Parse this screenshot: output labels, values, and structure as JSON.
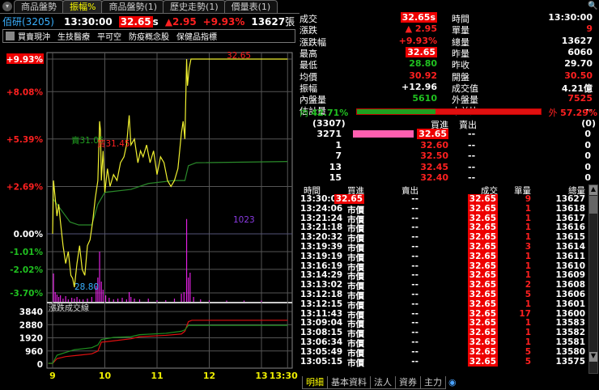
{
  "tabs": [
    "商品盤勢",
    "振幅%",
    "商品盤勢(1)",
    "歷史走勢(1)",
    "價量表(1)"
  ],
  "active_tab": 1,
  "header": {
    "stock": "佰研(3205)",
    "time": "13:30:00",
    "price": "32.65",
    "price_flag": "s",
    "change": "▲2.95",
    "pct": "+9.93%",
    "volume": "13627",
    "volume_unit": "張"
  },
  "toolbar": [
    "買賣現沖",
    "生技醫療",
    "平可空",
    "防疫概念股",
    "保健品指標"
  ],
  "quote_left": [
    {
      "label": "成交",
      "value": "32.65s",
      "color": "box"
    },
    {
      "label": "漲跌",
      "value": "▲ 2.95",
      "color": "red"
    },
    {
      "label": "漲跌幅",
      "value": "+9.93%",
      "color": "red"
    },
    {
      "label": "最高",
      "value": "32.65",
      "color": "box"
    },
    {
      "label": "最低",
      "value": "28.80",
      "color": "green"
    },
    {
      "label": "均價",
      "value": "30.92",
      "color": "red"
    },
    {
      "label": "振幅",
      "value": "+12.96",
      "color": "white"
    },
    {
      "label": "內盤量",
      "value": "5610",
      "color": "green"
    },
    {
      "label": "估計量",
      "value": "--",
      "color": "white"
    }
  ],
  "quote_right": [
    {
      "label": "時間",
      "value": "13:30:00",
      "color": "white"
    },
    {
      "label": "單量",
      "value": "9",
      "color": "red"
    },
    {
      "label": "總量",
      "value": "13627",
      "color": "white"
    },
    {
      "label": "昨量",
      "value": "6060",
      "color": "white"
    },
    {
      "label": "昨收",
      "value": "29.70",
      "color": "white"
    },
    {
      "label": "開盤",
      "value": "30.50",
      "color": "red"
    },
    {
      "label": "成交值",
      "value": "4.21億",
      "color": "white"
    },
    {
      "label": "外盤量",
      "value": "7525",
      "color": "red"
    },
    {
      "label": "本益比",
      "value": "--",
      "color": "white"
    }
  ],
  "inout": {
    "in_label": "內",
    "in_pct": "42.71%",
    "out_label": "外",
    "out_pct": "57.29%",
    "in_fraction": 0.4271
  },
  "orderbook": {
    "bid_total": "(3307)",
    "bid_header": "買進",
    "ask_header": "賣出",
    "ask_total": "(0)",
    "rows": [
      {
        "bid_vol": "3271",
        "bid": "32.65",
        "ask": "--",
        "ask_vol": "0",
        "bar": 1
      },
      {
        "bid_vol": "1",
        "bid": "32.60",
        "ask": "--",
        "ask_vol": "0",
        "bar": 0
      },
      {
        "bid_vol": "7",
        "bid": "32.50",
        "ask": "--",
        "ask_vol": "0",
        "bar": 0
      },
      {
        "bid_vol": "13",
        "bid": "32.45",
        "ask": "--",
        "ask_vol": "0",
        "bar": 0
      },
      {
        "bid_vol": "15",
        "bid": "32.40",
        "ask": "--",
        "ask_vol": "0",
        "bar": 0
      }
    ]
  },
  "ticks": {
    "headers": [
      "時間",
      "買進",
      "賣出",
      "成交",
      "單量",
      "總量"
    ],
    "rows": [
      [
        "13:30:00",
        "32.65",
        "--",
        "32.65",
        "9",
        "13627"
      ],
      [
        "13:24:06",
        "市價",
        "--",
        "32.65",
        "1",
        "13618"
      ],
      [
        "13:21:24",
        "市價",
        "--",
        "32.65",
        "1",
        "13617"
      ],
      [
        "13:21:18",
        "市價",
        "--",
        "32.65",
        "1",
        "13616"
      ],
      [
        "13:20:32",
        "市價",
        "--",
        "32.65",
        "1",
        "13615"
      ],
      [
        "13:19:39",
        "市價",
        "--",
        "32.65",
        "3",
        "13614"
      ],
      [
        "13:19:19",
        "市價",
        "--",
        "32.65",
        "1",
        "13611"
      ],
      [
        "13:16:19",
        "市價",
        "--",
        "32.65",
        "1",
        "13610"
      ],
      [
        "13:14:29",
        "市價",
        "--",
        "32.65",
        "1",
        "13609"
      ],
      [
        "13:13:02",
        "市價",
        "--",
        "32.65",
        "2",
        "13608"
      ],
      [
        "13:12:18",
        "市價",
        "--",
        "32.65",
        "5",
        "13606"
      ],
      [
        "13:12:15",
        "市價",
        "--",
        "32.65",
        "1",
        "13601"
      ],
      [
        "13:11:43",
        "市價",
        "--",
        "32.65",
        "17",
        "13600"
      ],
      [
        "13:09:04",
        "市價",
        "--",
        "32.65",
        "1",
        "13583"
      ],
      [
        "13:08:15",
        "市價",
        "--",
        "32.65",
        "1",
        "13582"
      ],
      [
        "13:06:34",
        "市價",
        "--",
        "32.65",
        "1",
        "13581"
      ],
      [
        "13:05:49",
        "市價",
        "--",
        "32.65",
        "5",
        "13580"
      ],
      [
        "13:05:15",
        "市價",
        "--",
        "32.65",
        "5",
        "13575"
      ]
    ]
  },
  "bottom_tabs": [
    "明細",
    "基本資料",
    "法人",
    "資券",
    "主力"
  ],
  "chart_data": [
    {
      "type": "line",
      "title": "振幅%",
      "prev_close": 29.7,
      "ytick_labels": [
        "+9.93%",
        "+8.08%",
        "+5.39%",
        "+2.69%",
        "0.00%",
        "-1.01%",
        "-2.02%",
        "-3.70%"
      ],
      "ytick_values": [
        9.93,
        8.08,
        5.39,
        2.69,
        0,
        -1.01,
        -2.02,
        -3.7
      ],
      "xticks": [
        "9",
        "10",
        "11",
        "12",
        "13",
        "13:30"
      ],
      "annotations": {
        "high": "32.65",
        "low": "28.80",
        "buy": "買31.45",
        "sell": "賣31.05",
        "max_vol": "1023"
      },
      "price": [
        [
          0,
          29.7
        ],
        [
          1,
          30.6
        ],
        [
          3,
          30.3
        ],
        [
          5,
          30.0
        ],
        [
          7,
          30.2
        ],
        [
          9,
          29.9
        ],
        [
          12,
          29.5
        ],
        [
          15,
          29.2
        ],
        [
          18,
          29.4
        ],
        [
          21,
          29.0
        ],
        [
          23,
          28.95
        ],
        [
          25,
          28.8
        ],
        [
          28,
          29.2
        ],
        [
          31,
          29.5
        ],
        [
          34,
          29.1
        ],
        [
          37,
          29.0
        ],
        [
          40,
          29.5
        ],
        [
          43,
          29.6
        ],
        [
          46,
          29.9
        ],
        [
          49,
          30.3
        ],
        [
          52,
          30.6
        ],
        [
          54,
          31.6
        ],
        [
          55,
          31.45
        ],
        [
          56,
          30.6
        ],
        [
          58,
          31.1
        ],
        [
          60,
          30.4
        ],
        [
          63,
          30.8
        ],
        [
          66,
          30.5
        ],
        [
          70,
          30.7
        ],
        [
          74,
          30.6
        ],
        [
          78,
          30.9
        ],
        [
          82,
          31.0
        ],
        [
          85,
          31.2
        ],
        [
          88,
          31.7
        ],
        [
          90,
          31.2
        ],
        [
          94,
          31.3
        ],
        [
          98,
          30.9
        ],
        [
          101,
          31.1
        ],
        [
          104,
          31.0
        ],
        [
          108,
          31.2
        ],
        [
          112,
          30.9
        ],
        [
          116,
          31.1
        ],
        [
          120,
          30.7
        ],
        [
          124,
          31.0
        ],
        [
          128,
          30.9
        ],
        [
          132,
          30.6
        ],
        [
          136,
          30.5
        ],
        [
          140,
          30.6
        ],
        [
          144,
          30.8
        ],
        [
          148,
          31.4
        ],
        [
          150,
          31.6
        ],
        [
          152,
          31.3
        ],
        [
          154,
          32.65
        ],
        [
          155,
          32.2
        ],
        [
          157,
          32.5
        ],
        [
          159,
          32.65
        ],
        [
          270,
          32.65
        ]
      ],
      "avg": [
        [
          0,
          30.3
        ],
        [
          10,
          30.1
        ],
        [
          20,
          29.9
        ],
        [
          30,
          29.85
        ],
        [
          45,
          29.85
        ],
        [
          52,
          30.2
        ],
        [
          60,
          30.4
        ],
        [
          90,
          30.45
        ],
        [
          110,
          30.55
        ],
        [
          140,
          30.6
        ],
        [
          152,
          30.6
        ],
        [
          156,
          30.85
        ],
        [
          165,
          30.9
        ],
        [
          270,
          30.92
        ]
      ],
      "volume": [
        [
          1,
          350
        ],
        [
          3,
          120
        ],
        [
          5,
          90
        ],
        [
          7,
          60
        ],
        [
          9,
          80
        ],
        [
          12,
          40
        ],
        [
          15,
          70
        ],
        [
          18,
          30
        ],
        [
          22,
          50
        ],
        [
          25,
          40
        ],
        [
          28,
          60
        ],
        [
          31,
          30
        ],
        [
          35,
          30
        ],
        [
          40,
          40
        ],
        [
          45,
          60
        ],
        [
          50,
          200
        ],
        [
          52,
          300
        ],
        [
          54,
          620
        ],
        [
          56,
          250
        ],
        [
          58,
          150
        ],
        [
          61,
          80
        ],
        [
          65,
          50
        ],
        [
          70,
          30
        ],
        [
          75,
          40
        ],
        [
          80,
          50
        ],
        [
          85,
          30
        ],
        [
          88,
          120
        ],
        [
          90,
          60
        ],
        [
          94,
          40
        ],
        [
          100,
          30
        ],
        [
          110,
          40
        ],
        [
          120,
          20
        ],
        [
          130,
          20
        ],
        [
          140,
          40
        ],
        [
          148,
          100
        ],
        [
          151,
          120
        ],
        [
          154,
          1023
        ],
        [
          156,
          300
        ],
        [
          158,
          360
        ],
        [
          162,
          60
        ],
        [
          170,
          30
        ],
        [
          180,
          20
        ],
        [
          200,
          15
        ],
        [
          220,
          15
        ],
        [
          240,
          15
        ]
      ]
    },
    {
      "type": "line",
      "title": "漲跌成交線",
      "ytick_labels": [
        "3840",
        "2880",
        "1920",
        "960",
        "0"
      ],
      "ytick_values": [
        3840,
        2880,
        1920,
        960,
        0
      ],
      "series": [
        {
          "name": "up",
          "color": "#e01010",
          "points": [
            [
              -5,
              50
            ],
            [
              0,
              50
            ],
            [
              5,
              400
            ],
            [
              15,
              550
            ],
            [
              30,
              650
            ],
            [
              45,
              750
            ],
            [
              52,
              950
            ],
            [
              56,
              1600
            ],
            [
              70,
              1700
            ],
            [
              90,
              1850
            ],
            [
              100,
              2000
            ],
            [
              130,
              2100
            ],
            [
              148,
              2200
            ],
            [
              152,
              2400
            ],
            [
              156,
              3100
            ],
            [
              160,
              3200
            ],
            [
              270,
              3200
            ]
          ]
        },
        {
          "name": "down",
          "color": "#209020",
          "points": [
            [
              -5,
              60
            ],
            [
              0,
              60
            ],
            [
              5,
              650
            ],
            [
              15,
              850
            ],
            [
              25,
              1050
            ],
            [
              45,
              1200
            ],
            [
              52,
              1400
            ],
            [
              56,
              1800
            ],
            [
              70,
              1950
            ],
            [
              90,
              2000
            ],
            [
              100,
              2150
            ],
            [
              130,
              2250
            ],
            [
              148,
              2400
            ],
            [
              152,
              2500
            ],
            [
              156,
              2830
            ],
            [
              270,
              2830
            ]
          ]
        }
      ]
    }
  ]
}
